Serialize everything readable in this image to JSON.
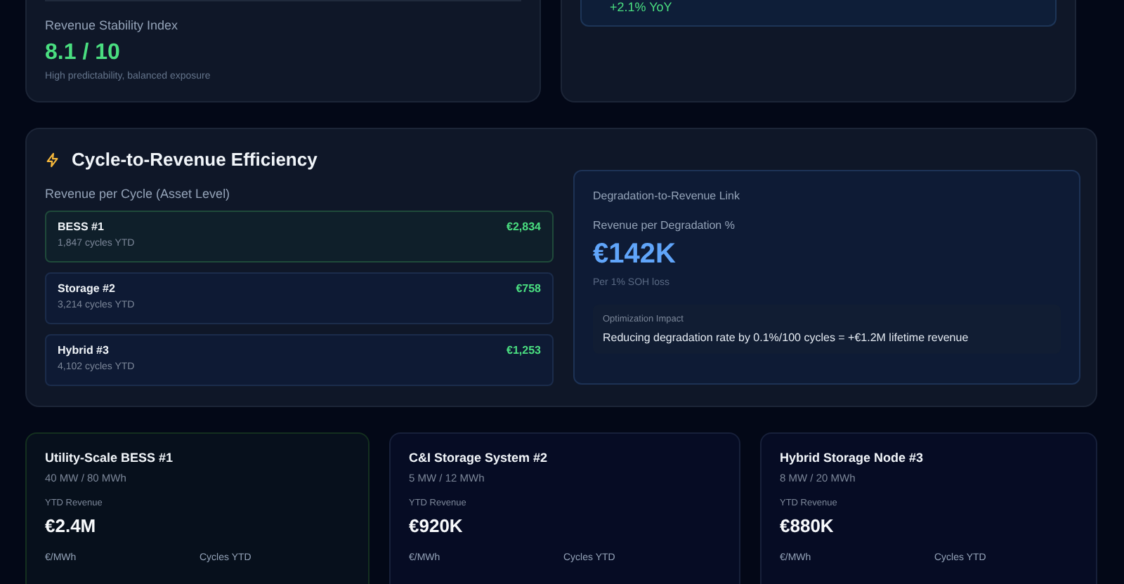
{
  "top_cards": [
    {
      "kind": "stability",
      "label": "Revenue Stability Index",
      "value": "8.1 / 10",
      "note": "High predictability, balanced exposure"
    },
    {
      "kind": "trend",
      "change": "+2.1% YoY"
    }
  ],
  "efficiency": {
    "title": "Cycle-to-Revenue Efficiency",
    "list_label": "Revenue per Cycle (Asset Level)",
    "assets": [
      {
        "name": "BESS #1",
        "cycles": "1,847 cycles YTD",
        "revenue": "€2,834",
        "selected": true
      },
      {
        "name": "Storage #2",
        "cycles": "3,214 cycles YTD",
        "revenue": "€758",
        "selected": false
      },
      {
        "name": "Hybrid #3",
        "cycles": "4,102 cycles YTD",
        "revenue": "€1,253",
        "selected": false
      }
    ],
    "degradation": {
      "title": "Degradation-to-Revenue Link",
      "label": "Revenue per Degradation %",
      "value": "€142K",
      "note": "Per 1% SOH loss",
      "impact_label": "Optimization Impact",
      "impact_text": "Reducing degradation rate by 0.1%/100 cycles = +€1.2M lifetime revenue"
    }
  },
  "asset_cards": [
    {
      "name": "Utility-Scale BESS #1",
      "capacity": "40 MW / 80 MWh",
      "revenue_label": "YTD Revenue",
      "revenue": "€2.4M",
      "metric_1": "€/MWh",
      "metric_2": "Cycles YTD",
      "selected": true
    },
    {
      "name": "C&I Storage System #2",
      "capacity": "5 MW / 12 MWh",
      "revenue_label": "YTD Revenue",
      "revenue": "€920K",
      "metric_1": "€/MWh",
      "metric_2": "Cycles YTD",
      "selected": false
    },
    {
      "name": "Hybrid Storage Node #3",
      "capacity": "8 MW / 20 MWh",
      "revenue_label": "YTD Revenue",
      "revenue": "€880K",
      "metric_1": "€/MWh",
      "metric_2": "Cycles YTD",
      "selected": false
    }
  ]
}
